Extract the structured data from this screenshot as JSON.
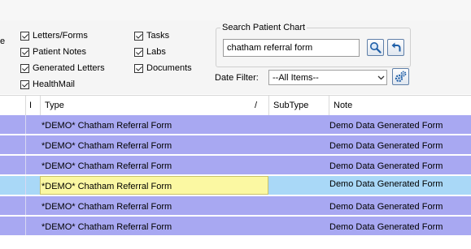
{
  "filters": {
    "edge_label": "e",
    "checkboxes": [
      {
        "label": "Letters/Forms",
        "checked": true
      },
      {
        "label": "Patient Notes",
        "checked": true
      },
      {
        "label": "Generated Letters",
        "checked": true
      },
      {
        "label": "HealthMail",
        "checked": true
      },
      {
        "label": "Tasks",
        "checked": true
      },
      {
        "label": "Labs",
        "checked": true
      },
      {
        "label": "Documents",
        "checked": true
      }
    ]
  },
  "search": {
    "legend": "Search Patient Chart",
    "value": "chatham referral form",
    "search_icon": "magnifier-icon",
    "back_icon": "back-arrow-icon"
  },
  "date_filter": {
    "label": "Date Filter:",
    "selected": "--All Items--",
    "settings_icon": "gears-icon"
  },
  "grid": {
    "columns": {
      "indicator": "I",
      "type": "Type",
      "sort_marker": "/",
      "subtype": "SubType",
      "note": "Note"
    },
    "rows": [
      {
        "type": "*DEMO* Chatham Referral Form",
        "subtype": "",
        "note": "Demo Data Generated Form"
      },
      {
        "type": "*DEMO* Chatham Referral Form",
        "subtype": "",
        "note": "Demo Data Generated Form"
      },
      {
        "type": "*DEMO* Chatham Referral Form",
        "subtype": "",
        "note": "Demo Data Generated Form"
      },
      {
        "type": "*DEMO* Chatham Referral Form",
        "subtype": "",
        "note": "Demo Data Generated Form"
      },
      {
        "type": "*DEMO* Chatham Referral Form",
        "subtype": "",
        "note": "Demo Data Generated Form"
      },
      {
        "type": "*DEMO* Chatham Referral Form",
        "subtype": "",
        "note": "Demo Data Generated Form"
      }
    ],
    "selected_row": 4
  },
  "colors": {
    "row_bg": "#a8a8f2",
    "selected_row_bg": "#a9d8f7",
    "selected_cell_bg": "#fbf8a2"
  }
}
